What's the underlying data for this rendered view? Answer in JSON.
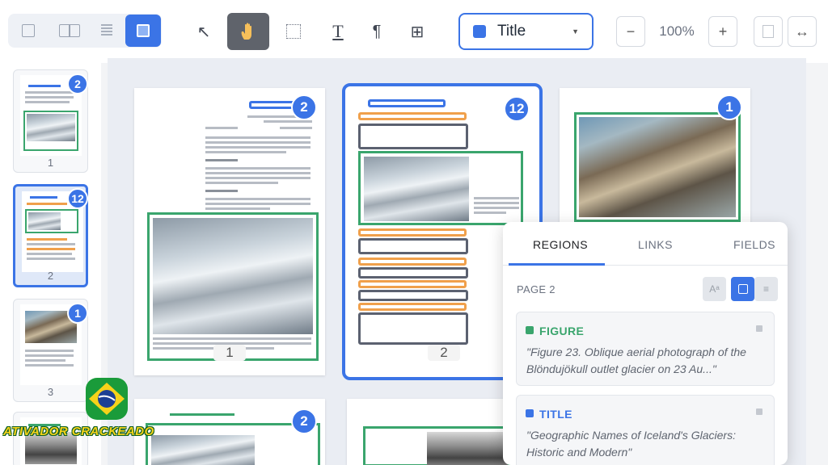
{
  "toolbar": {
    "view_modes": [
      "single-page",
      "two-page",
      "text-only",
      "full-page"
    ],
    "active_view": "full-page",
    "tools": [
      "select-arrow",
      "pan-hand",
      "draw-region",
      "text-region",
      "paragraph",
      "table"
    ],
    "active_tool": "pan-hand",
    "region_type": {
      "label": "Title",
      "color": "#3b74e6"
    },
    "zoom": {
      "minus": "−",
      "value": "100%",
      "plus": "+"
    },
    "fit_width_icon": "↔"
  },
  "sidebar": {
    "pages": [
      {
        "number": "1",
        "badge": "2"
      },
      {
        "number": "2",
        "badge": "12"
      },
      {
        "number": "3",
        "badge": "1"
      },
      {
        "number": "",
        "badge": ""
      }
    ],
    "selected_page": "2"
  },
  "canvas": {
    "pages": [
      {
        "number": "1",
        "badge": "2"
      },
      {
        "number": "2",
        "badge": "12"
      },
      {
        "number": "",
        "badge": "1"
      },
      {
        "number": "",
        "badge": "2"
      }
    ]
  },
  "panel": {
    "tabs": [
      "REGIONS",
      "LINKS",
      "FIELDS"
    ],
    "active_tab": "REGIONS",
    "page_label": "PAGE 2",
    "view_mode_icons": [
      "Aᵃ",
      "",
      "≡"
    ],
    "regions": [
      {
        "type": "FIGURE",
        "color": "#3aa56d",
        "text": "\"Figure 23. Oblique aerial photograph of the Blöndujökull outlet glacier on 23 Au...\""
      },
      {
        "type": "TITLE",
        "color": "#3b74e6",
        "text": "\"Geographic Names of Iceland's Glaciers: Historic and Modern\""
      }
    ]
  },
  "watermark": {
    "text": "ATIVADOR CRACKEADO"
  }
}
